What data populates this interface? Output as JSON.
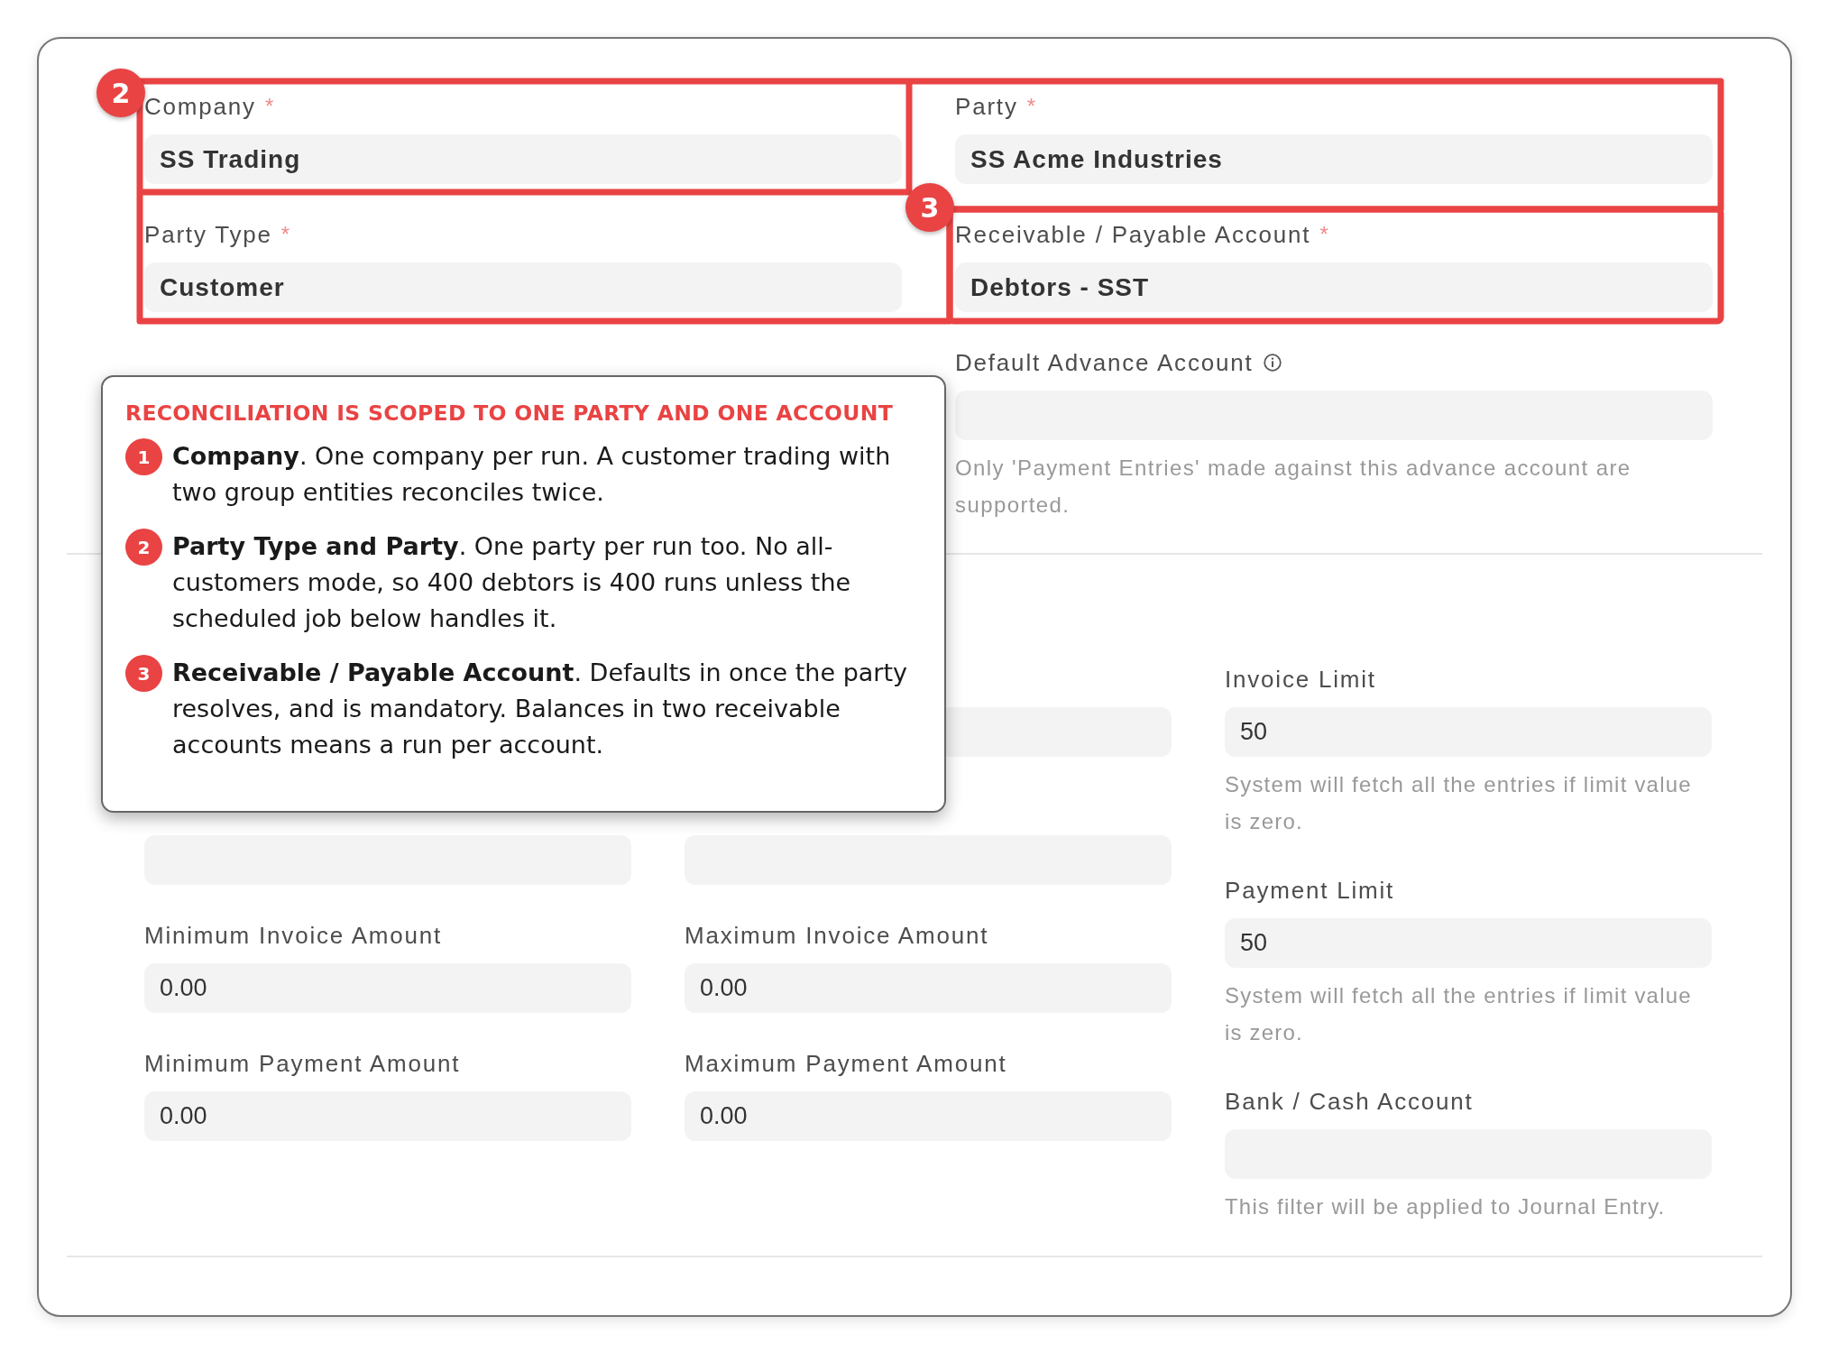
{
  "top_columns": [
    [
      {
        "label": "Company",
        "mark": "*",
        "value": "SS Trading"
      },
      {
        "label": "Party Type",
        "mark": "*",
        "value": "Customer"
      }
    ],
    [
      {
        "label": "Party",
        "mark": "*",
        "value": "SS Acme Industries"
      },
      {
        "label": "Receivable / Payable Account",
        "mark": "*",
        "value": "Debtors - SST"
      },
      {
        "label": "Default Advance Account",
        "info": true,
        "help": "Only 'Payment Entries' made against this advance account are supported."
      }
    ]
  ],
  "bottom_columns": [
    [
      {
        "kind": "covered"
      },
      {
        "kind": "field"
      },
      {
        "kind": "field",
        "label": "Minimum Invoice Amount",
        "value": "0.00"
      },
      {
        "kind": "field",
        "label": "Minimum Payment Amount",
        "value": "0.00"
      }
    ],
    [
      {
        "kind": "clipped"
      },
      {
        "kind": "field"
      },
      {
        "kind": "field",
        "label": "Maximum Invoice Amount",
        "value": "0.00"
      },
      {
        "kind": "field",
        "label": "Maximum Payment Amount",
        "value": "0.00"
      }
    ],
    [
      {
        "kind": "field",
        "label": "Invoice Limit",
        "value": "50",
        "help": "System will fetch all the entries if limit value is zero."
      },
      {
        "kind": "field",
        "label": "Payment Limit",
        "value": "50",
        "help": "System will fetch all the entries if limit value is zero."
      },
      {
        "kind": "field",
        "label": "Bank / Cash Account",
        "help": "This filter will be applied to Journal Entry."
      }
    ]
  ],
  "highlights": [
    {
      "number": "2"
    },
    {
      "number": "3"
    }
  ],
  "callout": {
    "title": "RECONCILIATION IS SCOPED TO ONE PARTY AND ONE ACCOUNT",
    "items": [
      {
        "number": "1",
        "text": "**Company**. One company per run. A customer trading with two group entities reconciles twice."
      },
      {
        "number": "2",
        "text": "**Party Type and Party**. One party per run too. No all-customers mode, so 400 debtors is 400 runs unless the scheduled job below handles it."
      },
      {
        "number": "3",
        "text": "**Receivable / Payable Account**. Defaults in once the party resolves, and is mandatory. Balances in two receivable accounts means a run per account."
      }
    ]
  }
}
